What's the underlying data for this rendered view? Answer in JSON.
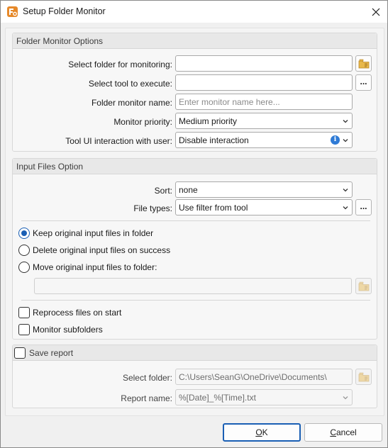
{
  "window": {
    "title": "Setup Folder Monitor"
  },
  "folder_monitor_options": {
    "title": "Folder Monitor Options",
    "select_folder_label": "Select folder for monitoring:",
    "select_folder_value": "",
    "select_tool_label": "Select tool to execute:",
    "select_tool_value": "",
    "browse_button_label": "...",
    "monitor_name_label": "Folder monitor name:",
    "monitor_name_placeholder": "Enter monitor name here...",
    "priority_label": "Monitor priority:",
    "priority_value": "Medium priority",
    "interaction_label": "Tool UI interaction with user:",
    "interaction_value": "Disable interaction",
    "info_glyph": "i"
  },
  "input_files_option": {
    "title": "Input Files Option",
    "sort_label": "Sort:",
    "sort_value": "none",
    "file_types_label": "File types:",
    "file_types_value": "Use filter from tool",
    "browse_button_label": "...",
    "radio_keep": "Keep original input files in folder",
    "radio_delete": "Delete original input files on success",
    "radio_move": "Move original input files to folder:",
    "move_folder_value": "",
    "reprocess_label": "Reprocess files on start",
    "subfolders_label": "Monitor subfolders",
    "selected_radio": "keep"
  },
  "save_report": {
    "title": "Save report",
    "select_folder_label": "Select folder:",
    "select_folder_value": "C:\\Users\\SeanG\\OneDrive\\Documents\\",
    "report_name_label": "Report name:",
    "report_name_value": "%[Date]_%[Time].txt"
  },
  "footer": {
    "ok_prefix": "",
    "ok_underlined": "O",
    "ok_rest": "K",
    "cancel_underlined": "C",
    "cancel_rest": "ancel"
  },
  "colors": {
    "accent": "#1a5fb4",
    "folder_icon": "#e8b84a",
    "app_icon": "#e6892a"
  },
  "icons": {
    "app": "app-logo-icon",
    "close": "close-icon",
    "folder": "folder-browse-icon",
    "dropdown": "chevron-down-icon",
    "info": "info-icon"
  }
}
